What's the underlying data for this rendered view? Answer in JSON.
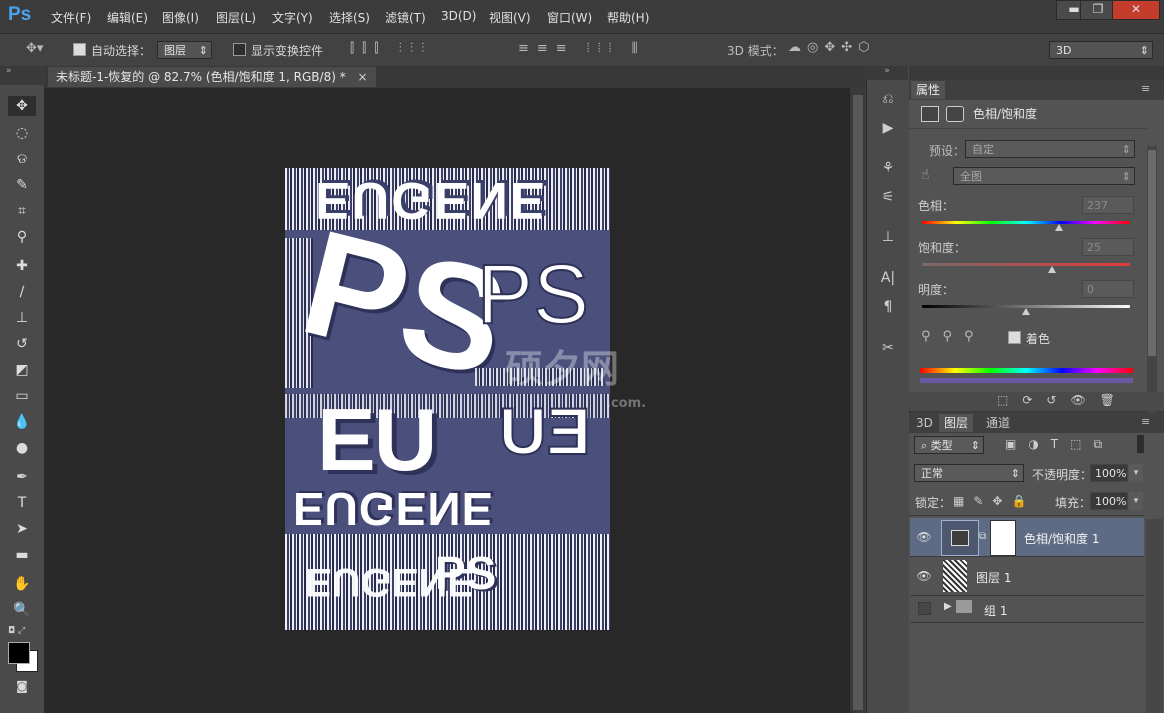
{
  "app": {
    "logo": "Ps"
  },
  "menu": [
    "文件(F)",
    "编辑(E)",
    "图像(I)",
    "图层(L)",
    "文字(Y)",
    "选择(S)",
    "滤镜(T)",
    "3D(D)",
    "视图(V)",
    "窗口(W)",
    "帮助(H)"
  ],
  "window_controls": {
    "minimize": "▬",
    "restore": "❐",
    "close": "✕"
  },
  "options": {
    "auto_select_label": "自动选择：",
    "auto_select_value": "图层",
    "show_transform_label": "显示变换控件",
    "mode_3d_label": "3D 模式：",
    "workspace_value": "3D"
  },
  "document": {
    "tab_title": "未标题-1-恢复的 @ 82.7% (色相/饱和度 1, RGB/8) *",
    "tab_close": "×"
  },
  "properties": {
    "tab": "属性",
    "adjustment_name": "色相/饱和度",
    "preset_label": "预设：",
    "preset_value": "自定",
    "channel_value": "全图",
    "hue_label": "色相：",
    "hue_value": 237,
    "hue_max": 360,
    "saturation_label": "饱和度：",
    "saturation_value": 25,
    "saturation_max": 100,
    "lightness_label": "明度：",
    "lightness_value": 0,
    "lightness_max": 100,
    "colorize_label": "着色",
    "colorize_checked": true
  },
  "layers_panel": {
    "tabs": [
      "3D",
      "图层",
      "通道"
    ],
    "active_tab": "图层",
    "filter_value": "类型",
    "blend_mode": "正常",
    "opacity_label": "不透明度：",
    "opacity_value": "100%",
    "lock_label": "锁定：",
    "fill_label": "填充：",
    "fill_value": "100%",
    "layers": [
      {
        "name": "色相/饱和度 1",
        "visible": true,
        "selected": true
      },
      {
        "name": "图层 1",
        "visible": true,
        "selected": false
      },
      {
        "name": "组 1",
        "visible": false,
        "selected": false
      }
    ]
  },
  "artwork": {
    "top_word": "EUGENE",
    "ps_large": "PS",
    "ps_right": "PS",
    "eu": "EU",
    "eugene_mid": "EUGENE",
    "ps_bottom": "PS",
    "bottom_word": "EUGENE",
    "watermark": "硕夕网",
    "watermark_sub": ".com."
  },
  "colors": {
    "poster_bg": "#4a4f7c",
    "accent": "#4aa3ee"
  }
}
